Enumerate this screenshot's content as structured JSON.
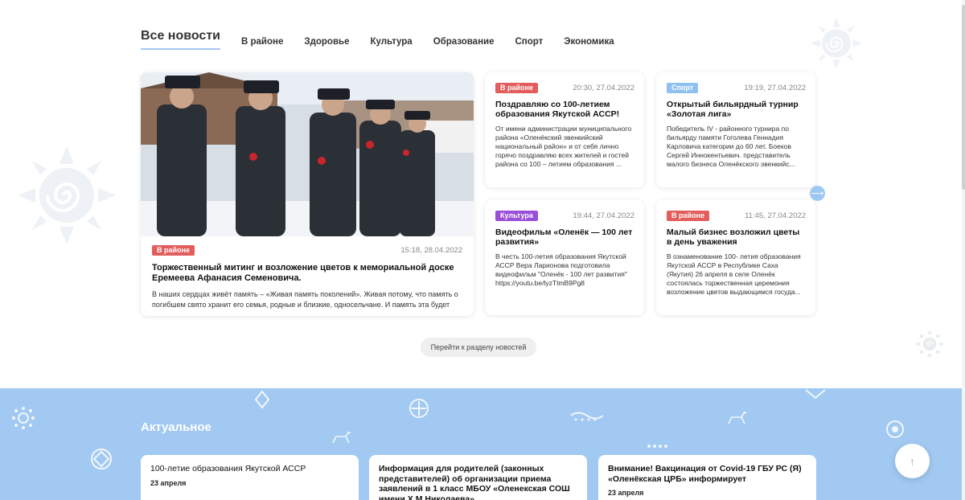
{
  "tabs": [
    {
      "label": "Все новости"
    },
    {
      "label": "В районе"
    },
    {
      "label": "Здоровье"
    },
    {
      "label": "Культура"
    },
    {
      "label": "Образование"
    },
    {
      "label": "Спорт"
    },
    {
      "label": "Экономика"
    }
  ],
  "featured": {
    "badge": "В районе",
    "date": "15:18, 28.04.2022",
    "title": "Торжественный митинг и возложение цветов к мемориальной доске Еремеева Афанасия Семеновича.",
    "text": "В наших сердцах живёт память – «Живая память поколений». Живая потому, что память о погибшем свято хранит его семья, родные и близкие, односельчане. И память эта будет"
  },
  "news": [
    {
      "badge": "В районе",
      "date": "20:30, 27.04.2022",
      "title": "Поздравляю со 100-летием образования Якутской АССР!",
      "text": "От имени администрации муниципального района «Оленёкский эвенкийский национальный район» и от себя лично горячо поздравляю всех жителей и гостей района со 100 – летием образования ..."
    },
    {
      "badge": "Спорт",
      "date": "19:19, 27.04.2022",
      "title": "Открытый бильярдный турнир «Золотая лига»",
      "text": "Победитель IV - районного турнира по бильярду памяти Гоголева Геннадия Карловича категории до 60 лет. Боеков Сергей Иннокентьевич. представитель малого бизнеса Оленёкского эвенкийс..."
    },
    {
      "badge": "Культура",
      "date": "19:44, 27.04.2022",
      "title": "Видеофильм «Оленёк — 100 лет развития»",
      "text": "В честь 100-летия образования Якутской АССР Вера Ларионова подготовила видеофильм \"Оленёк - 100 лет развития\" https://youtu.be/lyzTtmB9Pg8"
    },
    {
      "badge": "В районе",
      "date": "11:45, 27.04.2022",
      "title": "Малый бизнес возложил цветы в день уважения",
      "text": "В ознаменование 100- летия образования Якутской АССР в Республике Саха (Якутия) 26 апреля в селе Оленёк состоялась торжественная церемония возложение цветов выдающимся госуда..."
    }
  ],
  "more_button": "Перейти к разделу новостей",
  "actual": {
    "title": "Актуальное",
    "items": [
      {
        "title": "100-летие образования Якутской АССР",
        "date": "23 апреля"
      },
      {
        "title": "Информация для родителей (законных представителей) об организации приема заявлений в 1 класс МБОУ «Оленекская СОШ имени Х.М.Николаева»",
        "date": ""
      },
      {
        "title": "Внимание! Вакцинация от Covid-19 ГБУ РС (Я) «Оленёкская ЦРБ» информирует",
        "date": "23 апреля"
      }
    ]
  },
  "icons": {
    "next": "arrow-right-icon",
    "up": "arrow-up-icon"
  },
  "colors": {
    "accent_blue": "#a1c9f1",
    "badge_red": "#e35d5d",
    "badge_blue": "#8fc1ef",
    "badge_purple": "#9a4fd9"
  }
}
